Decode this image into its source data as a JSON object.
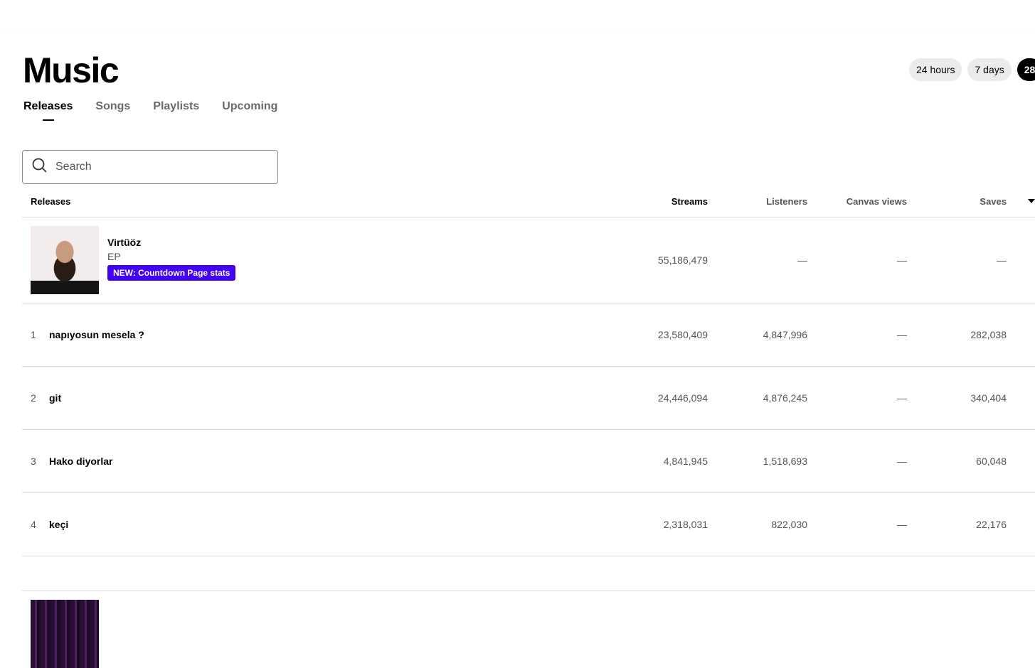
{
  "page": {
    "title": "Music"
  },
  "tabs": [
    {
      "label": "Releases"
    },
    {
      "label": "Songs"
    },
    {
      "label": "Playlists"
    },
    {
      "label": "Upcoming"
    }
  ],
  "ranges": [
    {
      "label": "24 hours"
    },
    {
      "label": "7 days"
    },
    {
      "label": "28"
    }
  ],
  "search": {
    "placeholder": "Search"
  },
  "table": {
    "headers": {
      "release": "Releases",
      "streams": "Streams",
      "listeners": "Listeners",
      "canvas": "Canvas views",
      "saves": "Saves"
    },
    "release": {
      "title": "Virtüöz",
      "type": "EP",
      "badge": "NEW: Countdown Page stats",
      "streams": "55,186,479",
      "listeners": "—",
      "canvas": "—",
      "saves": "—"
    },
    "tracks": [
      {
        "index": "1",
        "title": "napıyosun mesela ?",
        "streams": "23,580,409",
        "listeners": "4,847,996",
        "canvas": "—",
        "saves": "282,038"
      },
      {
        "index": "2",
        "title": "git",
        "streams": "24,446,094",
        "listeners": "4,876,245",
        "canvas": "—",
        "saves": "340,404"
      },
      {
        "index": "3",
        "title": "Hako diyorlar",
        "streams": "4,841,945",
        "listeners": "1,518,693",
        "canvas": "—",
        "saves": "60,048"
      },
      {
        "index": "4",
        "title": "keçi",
        "streams": "2,318,031",
        "listeners": "822,030",
        "canvas": "—",
        "saves": "22,176"
      }
    ]
  }
}
